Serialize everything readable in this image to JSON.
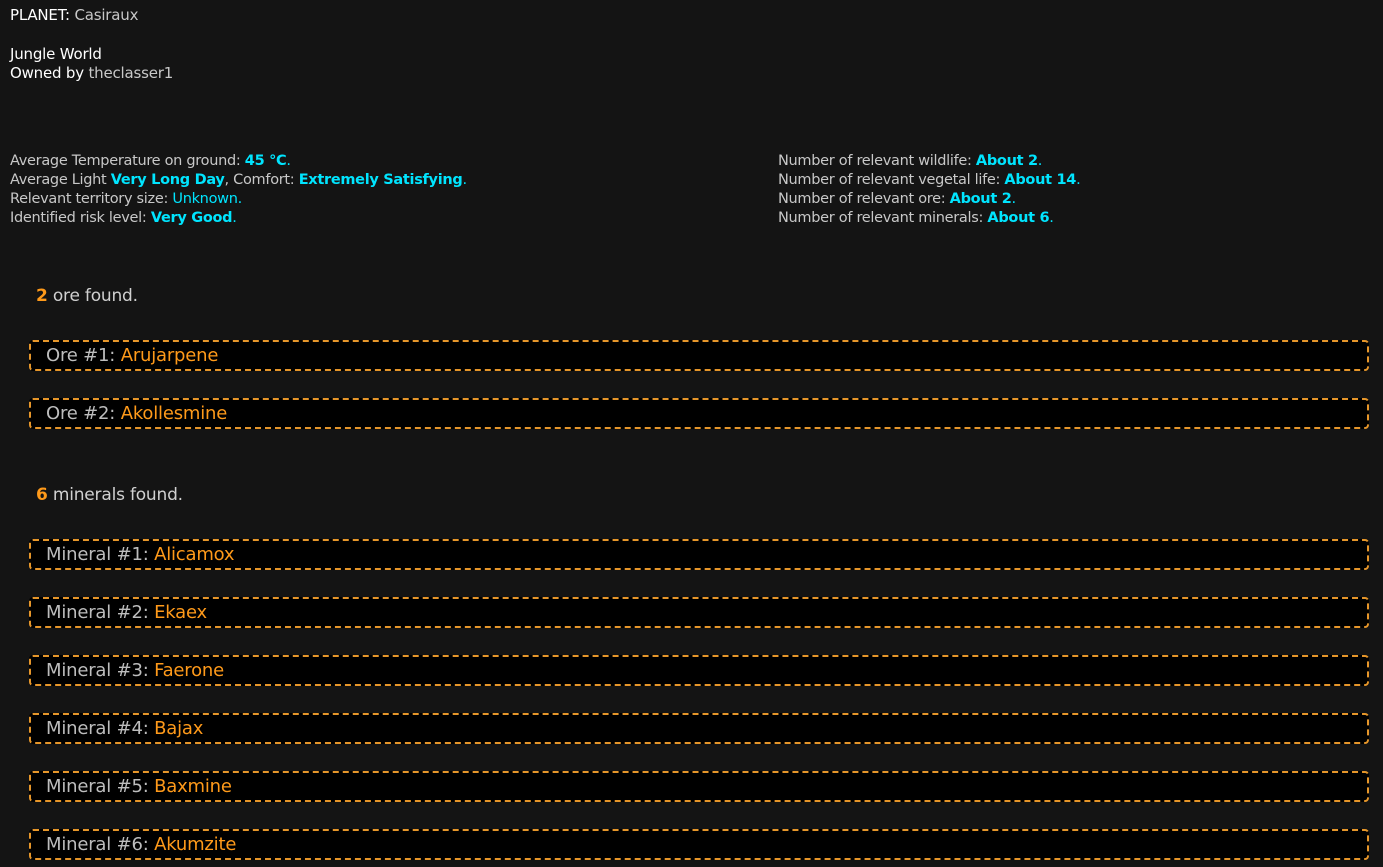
{
  "planet": {
    "label": "PLANET:",
    "name": "Casiraux",
    "type": "Jungle World",
    "owner_label": "Owned by",
    "owner": "theclasser1"
  },
  "stats_left": [
    {
      "label": "Average Temperature on ground: ",
      "value": "45 °C",
      "suffix": "."
    },
    {
      "label": "Average Light ",
      "value": "Very Long Day",
      "mid": ", Comfort: ",
      "value2": "Extremely Satisfying",
      "suffix": "."
    },
    {
      "label": "Relevant territory size: ",
      "value": "Unknown",
      "suffix": "."
    },
    {
      "label": "Identified risk level: ",
      "value": "Very Good",
      "suffix": "."
    }
  ],
  "stats_right": [
    {
      "label": "Number of relevant wildlife: ",
      "value": "About 2",
      "suffix": "."
    },
    {
      "label": "Number of relevant vegetal life: ",
      "value": "About 14",
      "suffix": "."
    },
    {
      "label": "Number of relevant ore: ",
      "value": "About 2",
      "suffix": "."
    },
    {
      "label": "Number of relevant minerals: ",
      "value": "About 6",
      "suffix": "."
    }
  ],
  "ore": {
    "count": "2",
    "text": " ore found.",
    "items": [
      {
        "label": "Ore #1: ",
        "name": "Arujarpene"
      },
      {
        "label": "Ore #2: ",
        "name": "Akollesmine"
      }
    ]
  },
  "minerals": {
    "count": "6",
    "text": " minerals found.",
    "items": [
      {
        "label": "Mineral #1: ",
        "name": "Alicamox"
      },
      {
        "label": "Mineral #2: ",
        "name": "Ekaex"
      },
      {
        "label": "Mineral #3: ",
        "name": "Faerone"
      },
      {
        "label": "Mineral #4: ",
        "name": "Bajax"
      },
      {
        "label": "Mineral #5: ",
        "name": "Baxmine"
      },
      {
        "label": "Mineral #6: ",
        "name": "Akumzite"
      }
    ]
  },
  "colors": {
    "background": "#141414",
    "accent_orange": "#ff9a1a",
    "accent_cyan": "#00e5ff",
    "border_dashed": "#e6962a"
  }
}
